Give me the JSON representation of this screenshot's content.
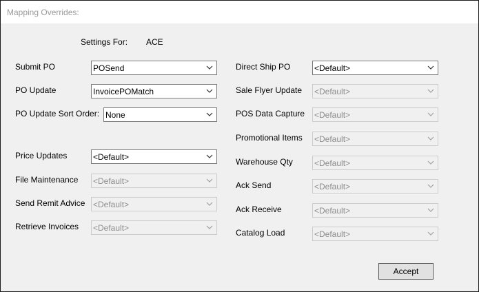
{
  "window": {
    "title": "Mapping Overrides:"
  },
  "settings": {
    "label": "Settings For:",
    "value": "ACE"
  },
  "left_fields": [
    {
      "label": "Submit PO",
      "value": "POSend",
      "enabled": true
    },
    {
      "label": "PO Update",
      "value": "InvoicePOMatch",
      "enabled": true
    },
    {
      "label": "PO Update Sort Order:",
      "value": "None",
      "enabled": true
    },
    {
      "label": "Price Updates",
      "value": "<Default>",
      "enabled": true
    },
    {
      "label": "File Maintenance",
      "value": "<Default>",
      "enabled": false
    },
    {
      "label": "Send Remit Advice",
      "value": "<Default>",
      "enabled": false
    },
    {
      "label": "Retrieve Invoices",
      "value": "<Default>",
      "enabled": false
    }
  ],
  "right_fields": [
    {
      "label": "Direct Ship PO",
      "value": "<Default>",
      "enabled": true
    },
    {
      "label": "Sale Flyer Update",
      "value": "<Default>",
      "enabled": false
    },
    {
      "label": "POS Data Capture",
      "value": "<Default>",
      "enabled": false
    },
    {
      "label": "Promotional Items",
      "value": "<Default>",
      "enabled": false
    },
    {
      "label": "Warehouse Qty",
      "value": "<Default>",
      "enabled": false
    },
    {
      "label": "Ack Send",
      "value": "<Default>",
      "enabled": false
    },
    {
      "label": "Ack Receive",
      "value": "<Default>",
      "enabled": false
    },
    {
      "label": "Catalog Load",
      "value": "<Default>",
      "enabled": false
    }
  ],
  "buttons": {
    "accept": "Accept"
  },
  "icons": {
    "dropdown": "chevron-down-icon"
  }
}
